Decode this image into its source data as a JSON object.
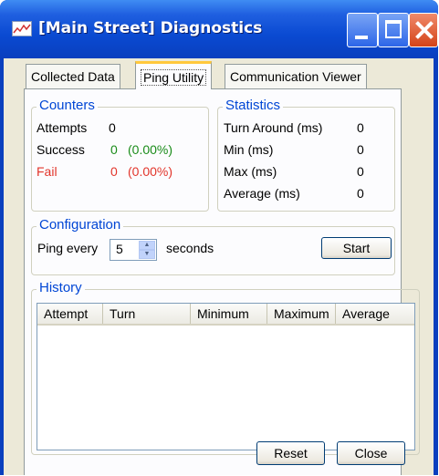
{
  "window": {
    "title": "[Main Street] Diagnostics"
  },
  "tabs": [
    {
      "label": "Collected Data"
    },
    {
      "label": "Ping Utility"
    },
    {
      "label": "Communication Viewer"
    }
  ],
  "counters": {
    "title": "Counters",
    "attempts_label": "Attempts",
    "attempts_value": "0",
    "success_label": "Success",
    "success_value": "0",
    "success_pct": "(0.00%)",
    "fail_label": "Fail",
    "fail_value": "0",
    "fail_pct": "(0.00%)"
  },
  "statistics": {
    "title": "Statistics",
    "rows": [
      {
        "label": "Turn Around (ms)",
        "value": "0"
      },
      {
        "label": "Min (ms)",
        "value": "0"
      },
      {
        "label": "Max (ms)",
        "value": "0"
      },
      {
        "label": "Average (ms)",
        "value": "0"
      }
    ]
  },
  "configuration": {
    "title": "Configuration",
    "ping_every_label": "Ping every",
    "interval_value": "5",
    "seconds_label": "seconds",
    "start_label": "Start"
  },
  "history": {
    "title": "History",
    "columns": [
      "Attempt",
      "Turn",
      "Minimum",
      "Maximum",
      "Average"
    ]
  },
  "buttons": {
    "reset": "Reset",
    "close": "Close"
  },
  "colors": {
    "title_bar": "#0a4ad2",
    "group_title": "#0046d5",
    "success": "#1a8c1a",
    "fail": "#e2352b",
    "active_tab_accent": "#ffc83c"
  }
}
